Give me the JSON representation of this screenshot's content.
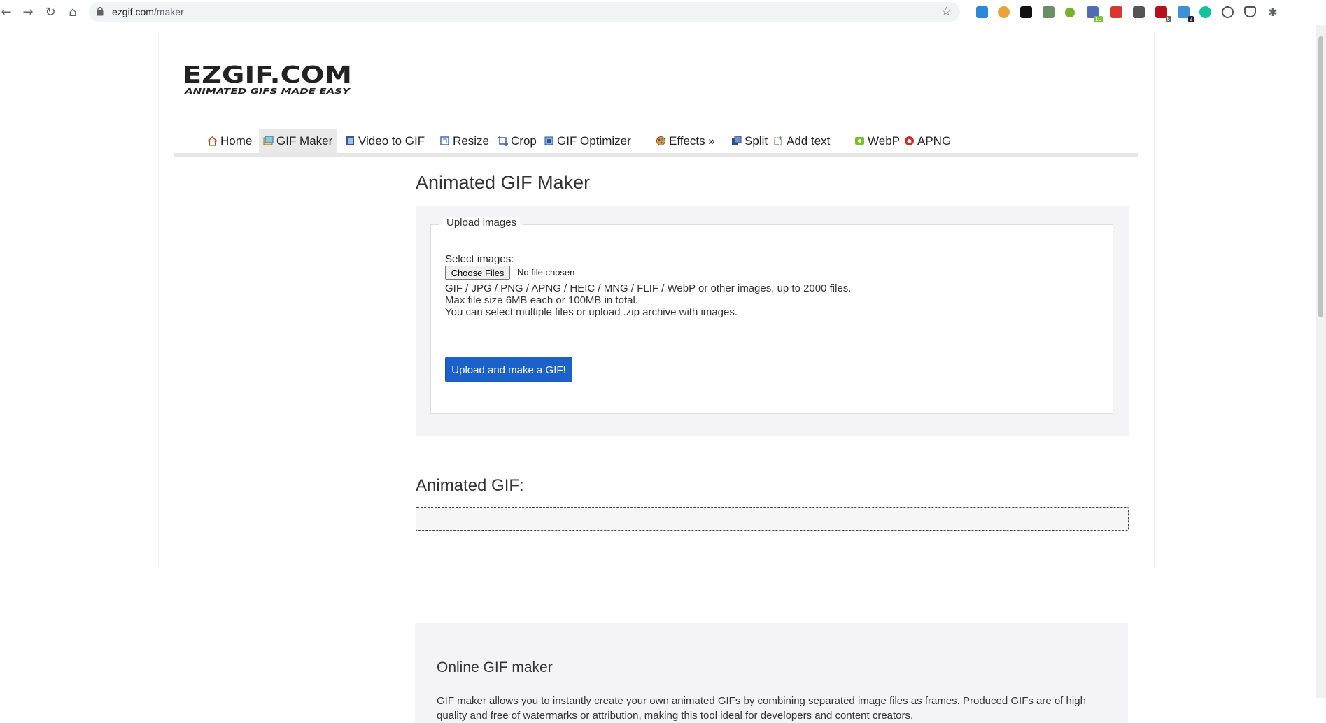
{
  "browser": {
    "url_host": "ezgif.com",
    "url_path": "/maker",
    "icons": [
      "back-icon",
      "forward-icon",
      "reload-icon",
      "home-icon",
      "lock-icon",
      "star-icon",
      "extensions-icon"
    ],
    "extension_badges": [
      "10",
      "5",
      "2"
    ]
  },
  "site": {
    "logo_title": "EZGIF.COM",
    "logo_tagline": "ANIMATED GIFS MADE EASY",
    "menu": [
      {
        "label": "Home",
        "icon": "home-icon",
        "active": false
      },
      {
        "label": "GIF Maker",
        "icon": "gif-maker-icon",
        "active": true
      },
      {
        "label": "Video to GIF",
        "icon": "video-icon",
        "active": false
      },
      {
        "label": "Resize",
        "icon": "resize-icon",
        "active": false
      },
      {
        "label": "Crop",
        "icon": "crop-icon",
        "active": false
      },
      {
        "label": "GIF Optimizer",
        "icon": "optimizer-icon",
        "active": false
      },
      {
        "label": "Effects »",
        "icon": "effects-icon",
        "active": false
      },
      {
        "label": "Split",
        "icon": "split-icon",
        "active": false
      },
      {
        "label": "Add text",
        "icon": "add-text-icon",
        "active": false
      },
      {
        "label": "WebP",
        "icon": "webp-icon",
        "active": false
      },
      {
        "label": "APNG",
        "icon": "apng-icon",
        "active": false
      }
    ]
  },
  "main": {
    "title": "Animated GIF Maker",
    "upload": {
      "legend": "Upload images",
      "select_label": "Select images:",
      "file_button": "Choose Files",
      "file_status": "No file chosen",
      "info_lines": [
        "GIF / JPG / PNG / APNG / HEIC / MNG / FLIF / WebP or other images, up to 2000 files.",
        "Max file size 6MB each or 100MB in total.",
        "You can select multiple files or upload .zip archive with images."
      ],
      "submit_label": "Upload and make a GIF!"
    },
    "output_title": "Animated GIF:"
  },
  "about": {
    "title": "Online GIF maker",
    "text": "GIF maker allows you to instantly create your own animated GIFs by combining separated image files as frames. Produced GIFs are of high quality and free of watermarks or attribution, making this tool ideal for developers and content creators."
  },
  "colors": {
    "primary_button": "#1b61c9",
    "panel_bg": "#f4f4f6"
  }
}
